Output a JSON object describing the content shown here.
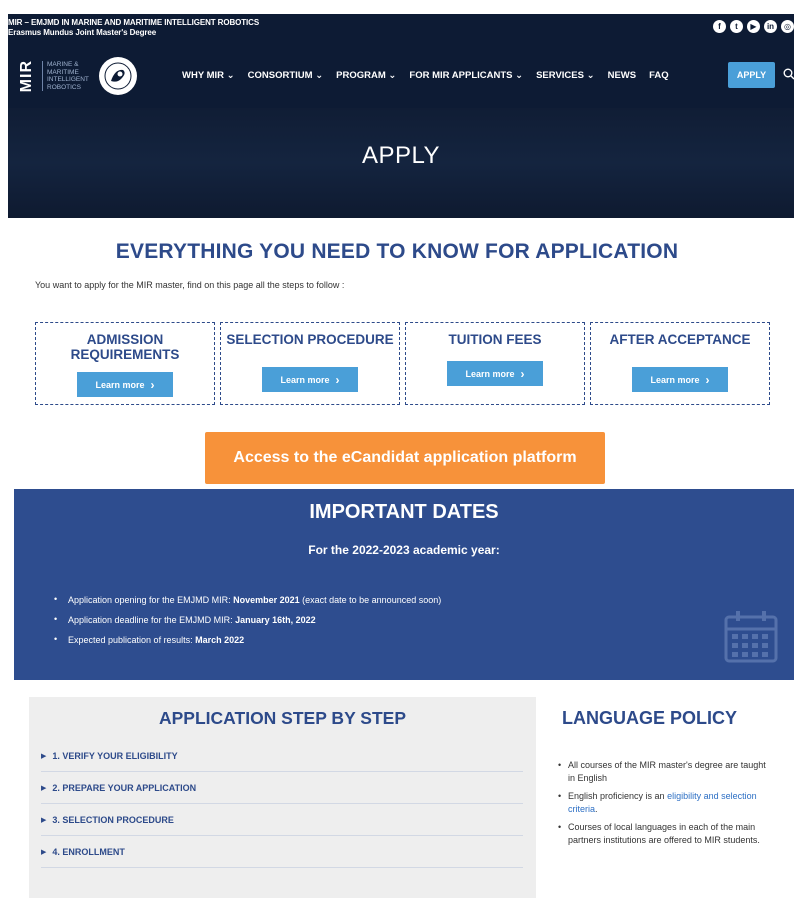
{
  "topbar": {
    "title_line1": "MIR – EMJMD IN MARINE AND MARITIME INTELLIGENT ROBOTICS",
    "title_line2": "Erasmus Mundus Joint Master's Degree",
    "social_icons": [
      "facebook-icon",
      "twitter-icon",
      "youtube-icon",
      "linkedin-icon",
      "instagram-icon"
    ]
  },
  "logo": {
    "mark": "MIR",
    "text_lines": [
      "MARINE &",
      "MARITIME",
      "INTELLIGENT",
      "ROBOTICS"
    ]
  },
  "nav": {
    "items": [
      "WHY MIR ⌄",
      "CONSORTIUM ⌄",
      "PROGRAM ⌄",
      "FOR MIR APPLICANTS ⌄",
      "SERVICES ⌄",
      "NEWS",
      "FAQ"
    ],
    "apply_label": "APPLY"
  },
  "hero": {
    "title": "APPLY"
  },
  "intro": {
    "title": "EVERYTHING YOU NEED TO KNOW FOR APPLICATION",
    "text": "You want to apply for the MIR master, find on this page all the steps to follow :"
  },
  "cards": [
    {
      "title": "ADMISSION REQUIREMENTS",
      "button": "Learn more"
    },
    {
      "title": "SELECTION PROCEDURE",
      "button": "Learn more"
    },
    {
      "title": "TUITION FEES",
      "button": "Learn more"
    },
    {
      "title": "AFTER ACCEPTANCE",
      "button": "Learn more"
    }
  ],
  "ecandidat_button": "Access to the eCandidat application platform",
  "dates": {
    "title": "IMPORTANT DATES",
    "subtitle": "For the 2022-2023 academic year:",
    "items": [
      {
        "label": "Application opening for the EMJMD MIR: ",
        "value": "November 2021",
        "suffix": " (exact date to be announced soon)"
      },
      {
        "label": "Application deadline for the EMJMD MIR: ",
        "value": "January 16th, 2022",
        "suffix": ""
      },
      {
        "label": "Expected publication of results: ",
        "value": "March 2022",
        "suffix": ""
      }
    ]
  },
  "steps": {
    "title": "APPLICATION STEP BY STEP",
    "items": [
      "1. VERIFY YOUR ELIGIBILITY",
      "2. PREPARE YOUR APPLICATION",
      "3. SELECTION PROCEDURE",
      "4. ENROLLMENT"
    ]
  },
  "language": {
    "title": "LANGUAGE POLICY",
    "item1": "All courses of the MIR master's degree are taught in English",
    "item2_prefix": "English proficiency is an ",
    "item2_link": "eligibility and selection criteria",
    "item2_suffix": ".",
    "item3": "Courses of local languages in each of the main partners institutions are offered to MIR students."
  },
  "colors": {
    "header_bg": "#0d1b34",
    "primary_blue": "#2d4a8a",
    "button_blue": "#4a9fd8",
    "orange": "#f7923a"
  }
}
